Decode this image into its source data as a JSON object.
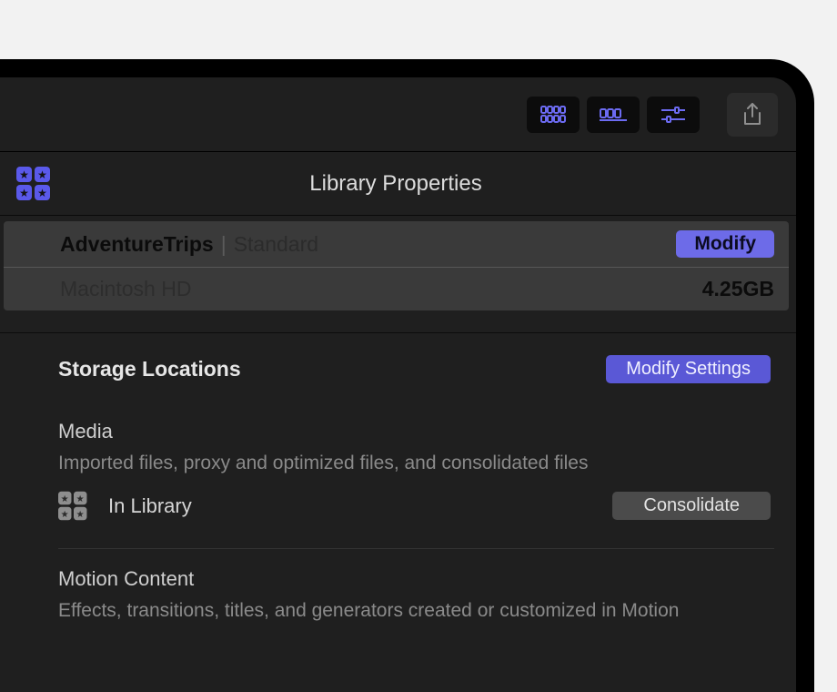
{
  "header": {
    "title": "Library Properties"
  },
  "library": {
    "name": "AdventureTrips",
    "mode": "Standard",
    "modify_label": "Modify",
    "location": "Macintosh HD",
    "size": "4.25GB"
  },
  "storage": {
    "title": "Storage Locations",
    "modify_settings_label": "Modify Settings",
    "media": {
      "title": "Media",
      "description": "Imported files, proxy and optimized files, and consolidated files",
      "location": "In Library",
      "consolidate_label": "Consolidate"
    },
    "motion": {
      "title": "Motion Content",
      "description": "Effects, transitions, titles, and generators created or customized in Motion"
    }
  }
}
